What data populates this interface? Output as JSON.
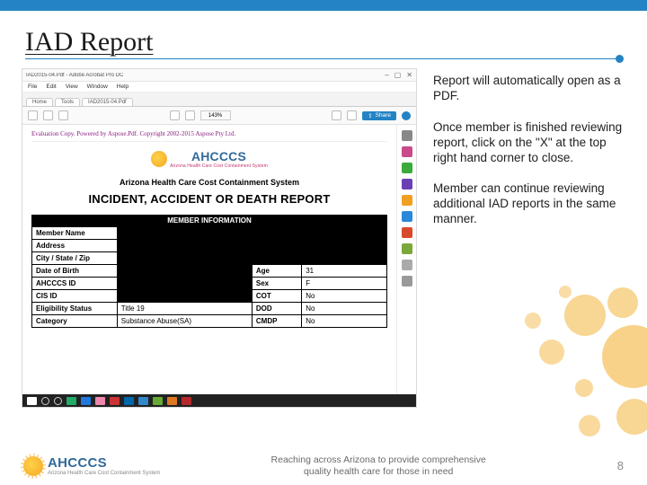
{
  "slide": {
    "title": "IAD Report",
    "page_number": "8",
    "tagline_line1": "Reaching across Arizona to provide comprehensive",
    "tagline_line2": "quality health care for those in need"
  },
  "footer_logo": {
    "text": "AHCCCS",
    "subtitle": "Arizona Health Care Cost Containment System"
  },
  "body_paragraphs": [
    "Report will automatically open as a PDF.",
    "Once member is finished reviewing report, click on the \"X\" at the top right hand corner to close.",
    "Member can continue reviewing additional IAD reports in the same manner."
  ],
  "pdf_window": {
    "filename": "IAD2015-04.Pdf - Adobe Acrobat Pro DC",
    "menus": [
      "File",
      "Edit",
      "View",
      "Window",
      "Help"
    ],
    "tabs": {
      "home": "Home",
      "tools": "Tools",
      "active": "IAD2015-04.Pdf"
    },
    "zoom": "143%",
    "share_label": "Share",
    "doc": {
      "running_header": "Evaluation Copy. Powered by Aspose.Pdf. Copyright 2002-2015 Aspose Pty Ltd.",
      "logo_text": "AHCCCS",
      "logo_subtitle": "Arizona Health Care Cost Containment System",
      "org_line": "Arizona Health Care Cost Containment System",
      "report_title": "INCIDENT, ACCIDENT OR DEATH REPORT",
      "section_header": "MEMBER INFORMATION",
      "fields": {
        "member_name": "Member Name",
        "address": "Address",
        "city_state_zip": "City / State / Zip",
        "dob": "Date of Birth",
        "ahcccs_id": "AHCCCS ID",
        "cis_id": "CIS ID",
        "eligibility_status": "Eligibility Status",
        "category": "Category",
        "age": "Age",
        "sex": "Sex",
        "cot": "COT",
        "dod": "DOD",
        "cmdp": "CMDP"
      },
      "values": {
        "age": "31",
        "sex": "F",
        "cot": "No",
        "dod": "No",
        "cmdp": "No",
        "eligibility_status": "Title 19",
        "category": "Substance Abuse(SA)"
      }
    }
  }
}
